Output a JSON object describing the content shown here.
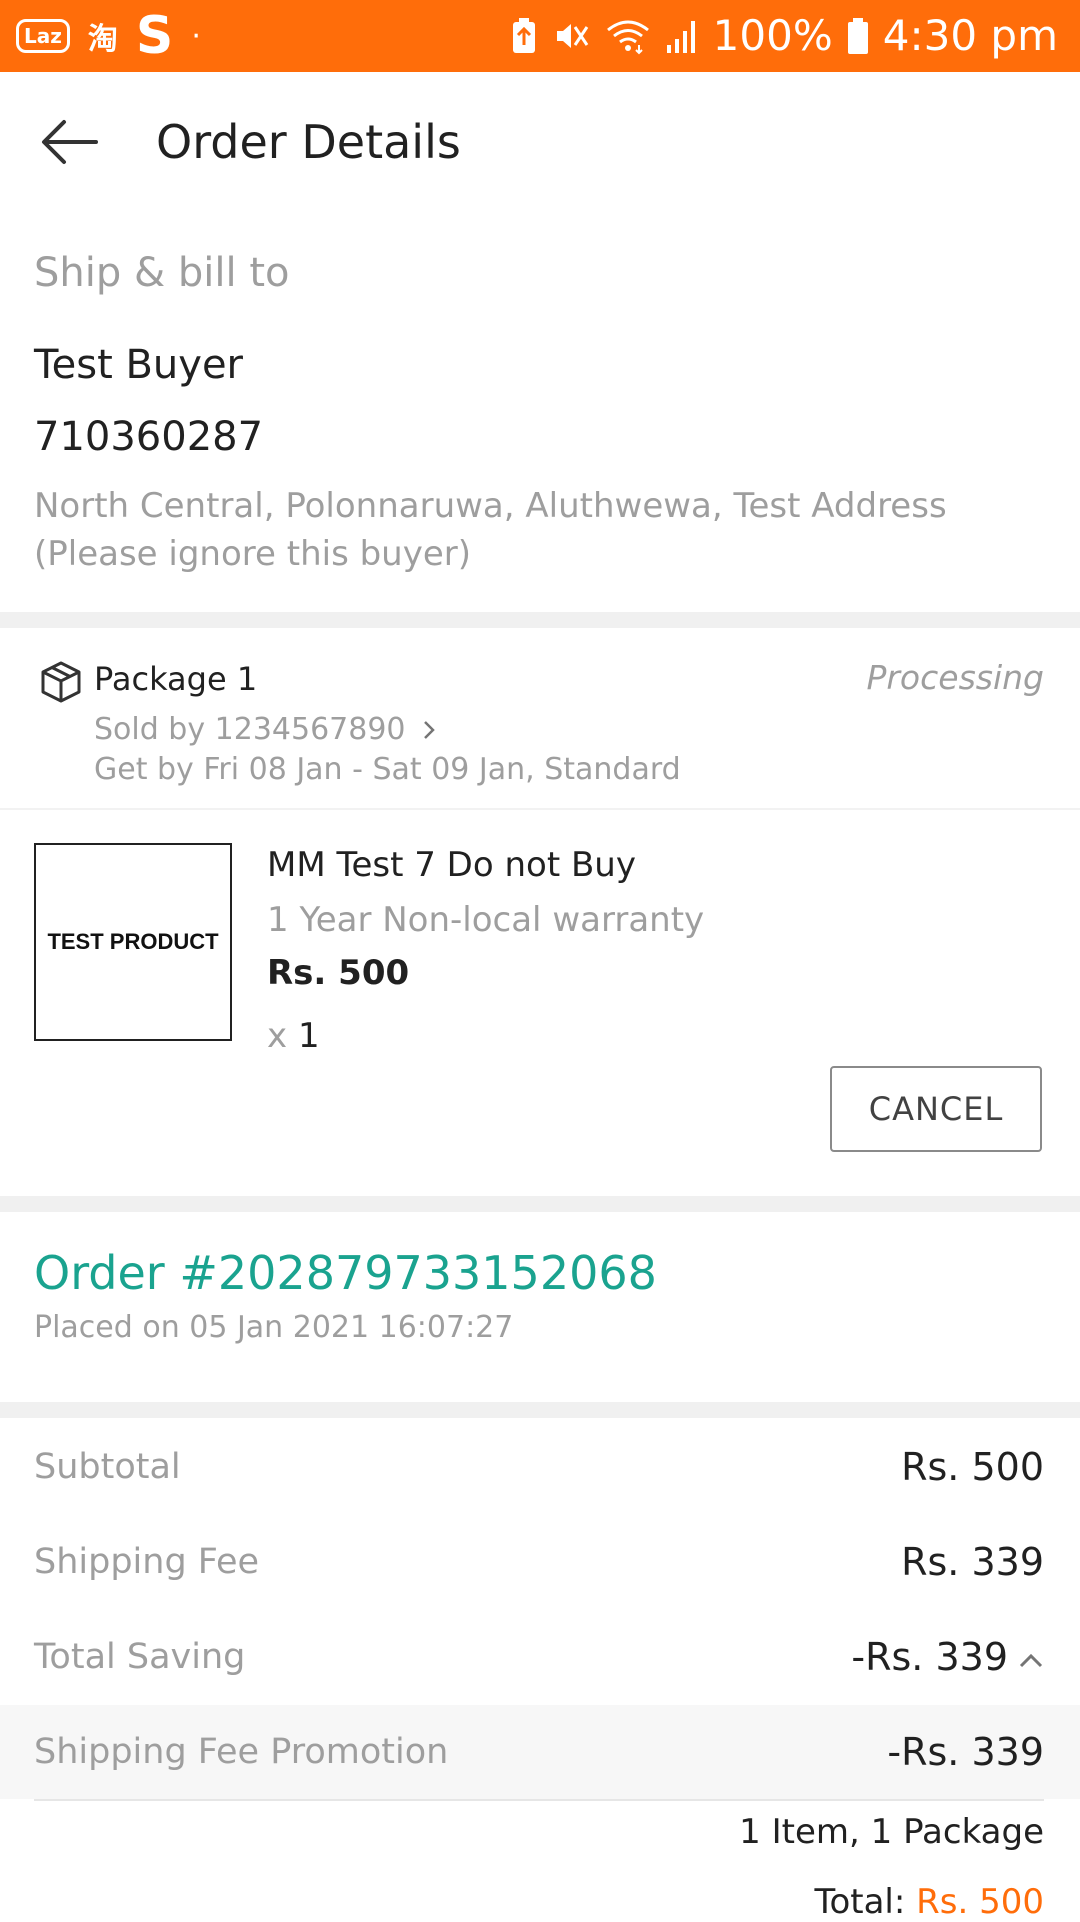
{
  "status_bar": {
    "app_icons": [
      "Laz",
      "淘",
      "S",
      "·"
    ],
    "battery_percent": "100%",
    "time": "4:30 pm",
    "icons": [
      "battery-saver-icon",
      "vibrate-off-icon",
      "wifi-icon",
      "signal-icon",
      "battery-icon"
    ]
  },
  "header": {
    "title": "Order Details"
  },
  "ship_to": {
    "label": "Ship & bill to",
    "name": "Test Buyer",
    "phone": "710360287",
    "address": "North Central, Polonnaruwa, Aluthwewa, Test Address (Please ignore this buyer)"
  },
  "package": {
    "title": "Package 1",
    "status": "Processing",
    "sold_by": "Sold by 1234567890",
    "delivery": "Get by Fri 08 Jan - Sat 09 Jan, Standard",
    "item": {
      "image_text": "TEST PRODUCT",
      "name": "MM Test 7 Do not Buy",
      "variant": "1 Year Non-local warranty",
      "price": "Rs. 500",
      "qty_prefix": "x",
      "qty": "1"
    },
    "cancel_label": "CANCEL"
  },
  "order": {
    "number": "Order #202879733152068",
    "placed": "Placed on 05 Jan 2021  16:07:27"
  },
  "summary": {
    "rows": [
      {
        "label": "Subtotal",
        "value": "Rs. 500"
      },
      {
        "label": "Shipping Fee",
        "value": "Rs. 339"
      },
      {
        "label": "Total Saving",
        "value": "-Rs. 339"
      },
      {
        "label": "Shipping Fee Promotion",
        "value": "-Rs. 339"
      }
    ],
    "items_count": "1 Item, 1 Package",
    "total_label": "Total:",
    "total_value": "Rs. 500"
  },
  "colors": {
    "brand_orange": "#ff6d0a",
    "order_teal": "#1aa38f"
  }
}
